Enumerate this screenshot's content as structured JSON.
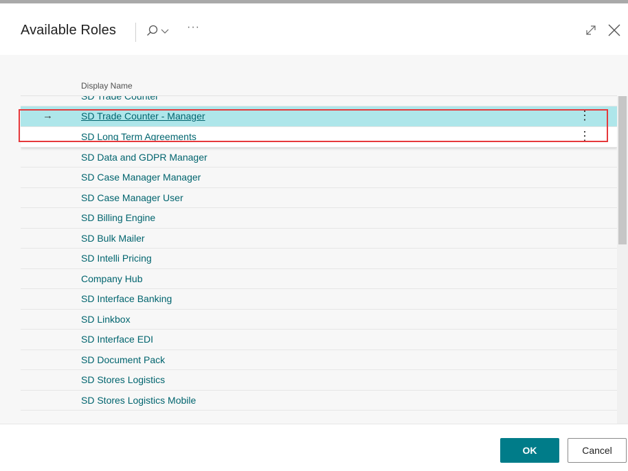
{
  "dialog": {
    "title": "Available Roles",
    "more_label": "···"
  },
  "list": {
    "column_header": "Display Name",
    "rows": [
      {
        "label": "SD Trade Counter"
      },
      {
        "label": "SD Trade Counter - Manager",
        "selected": true
      },
      {
        "label": "SD Long Term Agreements"
      },
      {
        "label": "SD Data and GDPR Manager"
      },
      {
        "label": "SD Case Manager Manager"
      },
      {
        "label": "SD Case Manager User"
      },
      {
        "label": "SD Billing Engine"
      },
      {
        "label": "SD Bulk Mailer"
      },
      {
        "label": "SD Intelli Pricing"
      },
      {
        "label": "Company Hub"
      },
      {
        "label": "SD Interface Banking"
      },
      {
        "label": "SD Linkbox"
      },
      {
        "label": "SD Interface EDI"
      },
      {
        "label": "SD Document Pack"
      },
      {
        "label": "SD Stores Logistics"
      },
      {
        "label": "SD Stores Logistics Mobile"
      }
    ],
    "selected_marker": "→",
    "row_menu_glyph": "⋮"
  },
  "footer": {
    "ok_label": "OK",
    "cancel_label": "Cancel"
  },
  "icons": {
    "search": "search-icon",
    "chevron": "chevron-down-icon",
    "expand": "expand-icon",
    "close": "close-icon"
  },
  "colors": {
    "accent": "#007c89",
    "link": "#00646e",
    "selected_row": "#aee6ea",
    "highlight_box": "#e5383b"
  }
}
